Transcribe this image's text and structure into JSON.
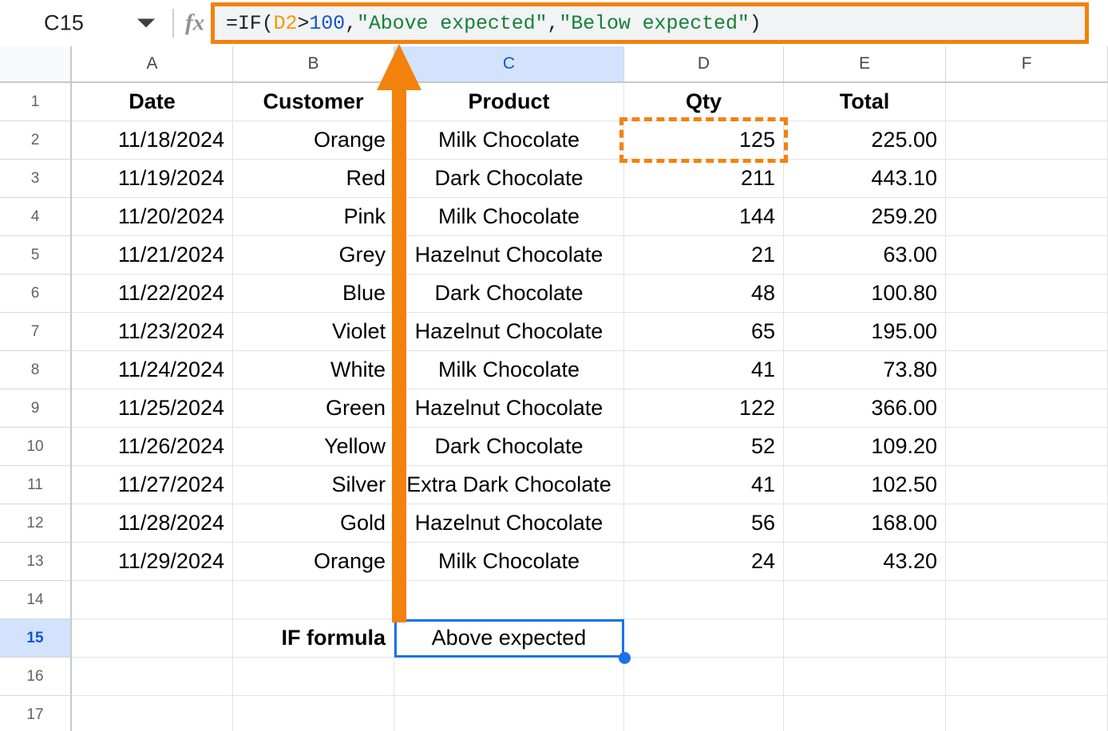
{
  "formula_bar": {
    "name_box_value": "C15",
    "name_box_caret_icon": "chevron-down-icon",
    "fx_icon": "fx-icon",
    "formula_full": "=IF(D2>100,\"Above expected\",\"Below expected\")",
    "formula_tokens": [
      {
        "text": "=IF(",
        "type": "plain"
      },
      {
        "text": "D2",
        "type": "ref"
      },
      {
        "text": ">",
        "type": "plain"
      },
      {
        "text": "100",
        "type": "num"
      },
      {
        "text": ",",
        "type": "plain"
      },
      {
        "text": "\"Above expected\"",
        "type": "str"
      },
      {
        "text": ",",
        "type": "plain"
      },
      {
        "text": "\"Below expected\"",
        "type": "str"
      },
      {
        "text": ")",
        "type": "plain"
      }
    ],
    "accent_color": "#f2820c"
  },
  "grid": {
    "column_headers": [
      "A",
      "B",
      "C",
      "D",
      "E",
      "F"
    ],
    "selected_column": "C",
    "row_headers": [
      "1",
      "2",
      "3",
      "4",
      "5",
      "6",
      "7",
      "8",
      "9",
      "10",
      "11",
      "12",
      "13",
      "14",
      "15",
      "16",
      "17"
    ],
    "selected_row": "15",
    "selected_cell": "C15",
    "selection_color": "#1a73e8",
    "header_selected_bg": "#d3e3fd",
    "table_headers": {
      "A": "Date",
      "B": "Customer",
      "C": "Product",
      "D": "Qty",
      "E": "Total"
    },
    "rows": [
      {
        "row": "2",
        "date": "11/18/2024",
        "customer": "Orange",
        "product": "Milk Chocolate",
        "qty": "125",
        "total": "225.00"
      },
      {
        "row": "3",
        "date": "11/19/2024",
        "customer": "Red",
        "product": "Dark Chocolate",
        "qty": "211",
        "total": "443.10"
      },
      {
        "row": "4",
        "date": "11/20/2024",
        "customer": "Pink",
        "product": "Milk Chocolate",
        "qty": "144",
        "total": "259.20"
      },
      {
        "row": "5",
        "date": "11/21/2024",
        "customer": "Grey",
        "product": "Hazelnut Chocolate",
        "qty": "21",
        "total": "63.00"
      },
      {
        "row": "6",
        "date": "11/22/2024",
        "customer": "Blue",
        "product": "Dark Chocolate",
        "qty": "48",
        "total": "100.80"
      },
      {
        "row": "7",
        "date": "11/23/2024",
        "customer": "Violet",
        "product": "Hazelnut Chocolate",
        "qty": "65",
        "total": "195.00"
      },
      {
        "row": "8",
        "date": "11/24/2024",
        "customer": "White",
        "product": "Milk Chocolate",
        "qty": "41",
        "total": "73.80"
      },
      {
        "row": "9",
        "date": "11/25/2024",
        "customer": "Green",
        "product": "Hazelnut Chocolate",
        "qty": "122",
        "total": "366.00"
      },
      {
        "row": "10",
        "date": "11/26/2024",
        "customer": "Yellow",
        "product": "Dark Chocolate",
        "qty": "52",
        "total": "109.20"
      },
      {
        "row": "11",
        "date": "11/27/2024",
        "customer": "Silver",
        "product": "Extra Dark Chocolate",
        "qty": "41",
        "total": "102.50"
      },
      {
        "row": "12",
        "date": "11/28/2024",
        "customer": "Gold",
        "product": "Hazelnut Chocolate",
        "qty": "56",
        "total": "168.00"
      },
      {
        "row": "13",
        "date": "11/29/2024",
        "customer": "Orange",
        "product": "Milk Chocolate",
        "qty": "24",
        "total": "43.20"
      }
    ],
    "result_row": {
      "row": "15",
      "label": "IF formula",
      "value": "Above expected"
    }
  },
  "annotations": {
    "highlighted_cell_ref": "D2",
    "highlighted_cell_value": "125",
    "highlight_style": "dashed-orange-box",
    "arrow": {
      "name": "pointer-arrow",
      "color": "#f2820c",
      "direction": "up",
      "points_from": "C15",
      "points_to": "column-C-header"
    }
  }
}
